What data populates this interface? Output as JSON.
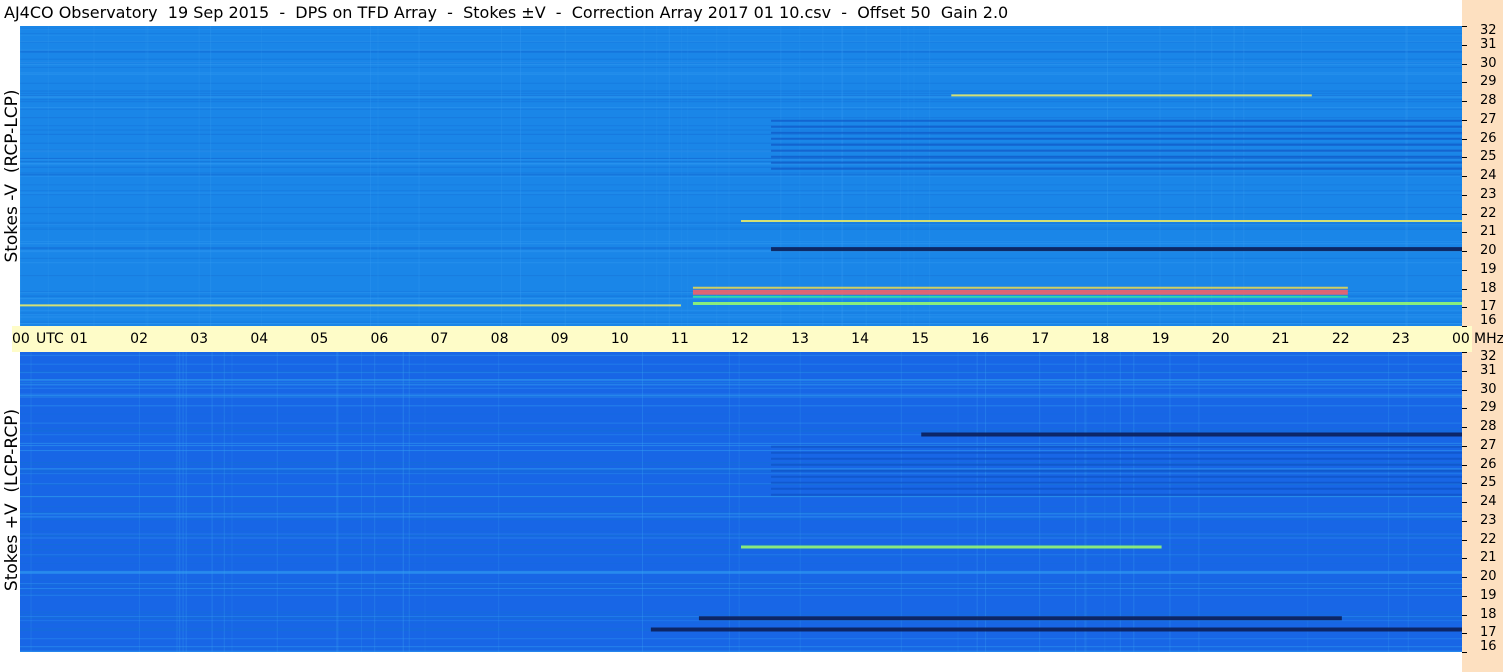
{
  "header": {
    "title": "AJ4CO Observatory  19 Sep 2015  -  DPS on TFD Array  -  Stokes ±V  -  Correction Array 2017 01 10.csv  -  Offset 50  Gain 2.0"
  },
  "colors": {
    "top_panel_base": "#1a86e8",
    "bottom_panel_base": "#1866e6",
    "time_axis_bg": "#fefcc8",
    "freq_axis_bg": "#fde0c0"
  },
  "chart_data": [
    {
      "type": "heatmap",
      "panel": "top",
      "ylabel": "Stokes -V  (RCP-LCP)",
      "x_unit": "UTC",
      "y_unit": "MHz",
      "xlim": [
        0,
        24
      ],
      "ylim": [
        16,
        32
      ],
      "y_ticks": [
        "32",
        "31",
        "30",
        "29",
        "28",
        "27",
        "26",
        "25",
        "24",
        "23",
        "22",
        "21",
        "20",
        "19",
        "18",
        "17",
        "16"
      ],
      "features": [
        {
          "kind": "band",
          "t_start": 11.2,
          "t_end": 22.1,
          "freq": 17.8,
          "intensity": "high"
        },
        {
          "kind": "band",
          "t_start": 11.2,
          "t_end": 24.0,
          "freq": 17.2,
          "intensity": "medium"
        },
        {
          "kind": "band",
          "t_start": 0.0,
          "t_end": 11.0,
          "freq": 17.1,
          "intensity": "low"
        },
        {
          "kind": "band",
          "t_start": 12.0,
          "t_end": 24.0,
          "freq": 21.6,
          "intensity": "low"
        },
        {
          "kind": "band",
          "t_start": 15.5,
          "t_end": 21.5,
          "freq": 28.3,
          "intensity": "low"
        },
        {
          "kind": "band",
          "t_start": 12.5,
          "t_end": 24.0,
          "freq": 20.1,
          "intensity": "dark"
        },
        {
          "kind": "striations",
          "t_start": 12.5,
          "t_end": 24.0,
          "freq_from": 24.2,
          "freq_to": 27.0
        }
      ]
    },
    {
      "type": "heatmap",
      "panel": "bottom",
      "ylabel": "Stokes +V  (LCP-RCP)",
      "x_unit": "UTC",
      "y_unit": "MHz",
      "xlim": [
        0,
        24
      ],
      "ylim": [
        16,
        32
      ],
      "y_ticks": [
        "32",
        "31",
        "30",
        "29",
        "28",
        "27",
        "26",
        "25",
        "24",
        "23",
        "22",
        "21",
        "20",
        "19",
        "18",
        "17",
        "16"
      ],
      "features": [
        {
          "kind": "band",
          "t_start": 11.3,
          "t_end": 22.0,
          "freq": 17.8,
          "intensity": "dark"
        },
        {
          "kind": "band",
          "t_start": 10.5,
          "t_end": 24.0,
          "freq": 17.2,
          "intensity": "dark"
        },
        {
          "kind": "band",
          "t_start": 12.0,
          "t_end": 19.0,
          "freq": 21.6,
          "intensity": "medium"
        },
        {
          "kind": "band",
          "t_start": 15.0,
          "t_end": 24.0,
          "freq": 27.6,
          "intensity": "dark"
        },
        {
          "kind": "striations",
          "t_start": 12.5,
          "t_end": 24.0,
          "freq_from": 24.2,
          "freq_to": 27.0
        }
      ]
    }
  ],
  "time_axis": {
    "ticks": [
      "00",
      "01",
      "02",
      "03",
      "04",
      "05",
      "06",
      "07",
      "08",
      "09",
      "10",
      "11",
      "12",
      "13",
      "14",
      "15",
      "16",
      "17",
      "18",
      "19",
      "20",
      "21",
      "22",
      "23",
      "00"
    ],
    "unit_label": "UTC",
    "freq_unit_label": "MHz"
  }
}
